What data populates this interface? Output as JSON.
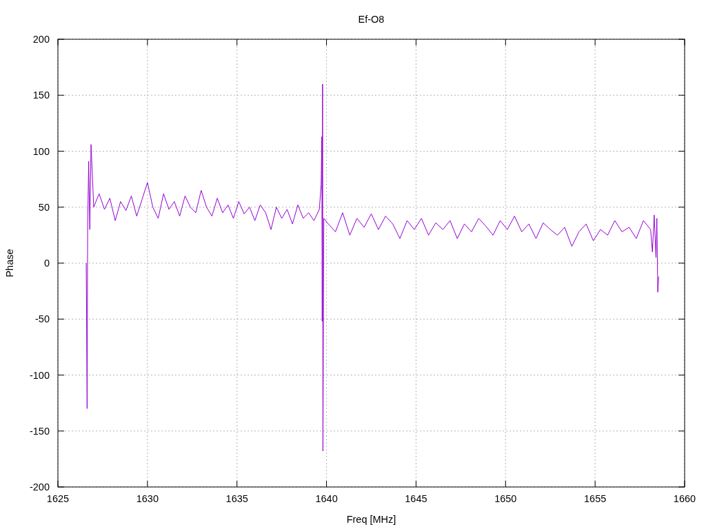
{
  "chart_data": {
    "type": "line",
    "title": "Ef-O8",
    "xlabel": "Freq [MHz]",
    "ylabel": "Phase",
    "x": [
      1626.58,
      1626.6,
      1626.63,
      1626.66,
      1626.72,
      1626.78,
      1626.85,
      1627.0,
      1627.3,
      1627.6,
      1627.9,
      1628.2,
      1628.5,
      1628.8,
      1629.1,
      1629.4,
      1629.7,
      1630.0,
      1630.3,
      1630.6,
      1630.9,
      1631.2,
      1631.5,
      1631.8,
      1632.1,
      1632.4,
      1632.7,
      1633.0,
      1633.3,
      1633.6,
      1633.9,
      1634.2,
      1634.5,
      1634.8,
      1635.1,
      1635.4,
      1635.7,
      1636.0,
      1636.3,
      1636.6,
      1636.9,
      1637.2,
      1637.5,
      1637.8,
      1638.1,
      1638.4,
      1638.7,
      1639.0,
      1639.3,
      1639.6,
      1639.7,
      1639.74,
      1639.76,
      1639.78,
      1639.8,
      1639.85,
      1640.1,
      1640.5,
      1640.9,
      1641.3,
      1641.7,
      1642.1,
      1642.5,
      1642.9,
      1643.3,
      1643.7,
      1644.1,
      1644.5,
      1644.9,
      1645.3,
      1645.7,
      1646.1,
      1646.5,
      1646.9,
      1647.3,
      1647.7,
      1648.1,
      1648.5,
      1648.9,
      1649.3,
      1649.7,
      1650.1,
      1650.5,
      1650.9,
      1651.3,
      1651.7,
      1652.1,
      1652.5,
      1652.9,
      1653.3,
      1653.7,
      1654.1,
      1654.5,
      1654.9,
      1655.3,
      1655.7,
      1656.1,
      1656.5,
      1656.9,
      1657.3,
      1657.7,
      1658.1,
      1658.2,
      1658.3,
      1658.4,
      1658.45,
      1658.5,
      1658.55
    ],
    "grid": true,
    "series": [
      {
        "color": "#9400d3",
        "values": [
          0,
          -45,
          -130,
          33,
          91,
          30,
          106,
          50,
          62,
          48,
          58,
          38,
          55,
          47,
          60,
          42,
          57,
          72,
          50,
          40,
          62,
          48,
          55,
          42,
          60,
          50,
          45,
          65,
          50,
          42,
          58,
          45,
          52,
          40,
          55,
          44,
          50,
          38,
          52,
          45,
          30,
          50,
          40,
          48,
          35,
          52,
          40,
          45,
          38,
          48,
          70,
          113,
          -52,
          160,
          -168,
          40,
          35,
          28,
          45,
          25,
          40,
          32,
          44,
          30,
          42,
          35,
          22,
          38,
          30,
          40,
          25,
          36,
          30,
          38,
          22,
          35,
          28,
          40,
          33,
          25,
          38,
          30,
          42,
          28,
          35,
          22,
          36,
          30,
          25,
          32,
          15,
          28,
          35,
          20,
          30,
          25,
          38,
          28,
          32,
          22,
          38,
          30,
          10,
          43,
          5,
          40,
          -26,
          -12
        ]
      }
    ],
    "xlim": [
      1625,
      1660
    ],
    "ylim": [
      -200,
      200
    ],
    "xticks": [
      1625,
      1630,
      1635,
      1640,
      1645,
      1650,
      1655,
      1660
    ],
    "yticks": [
      -200,
      -150,
      -100,
      -50,
      0,
      50,
      100,
      150,
      200
    ]
  }
}
